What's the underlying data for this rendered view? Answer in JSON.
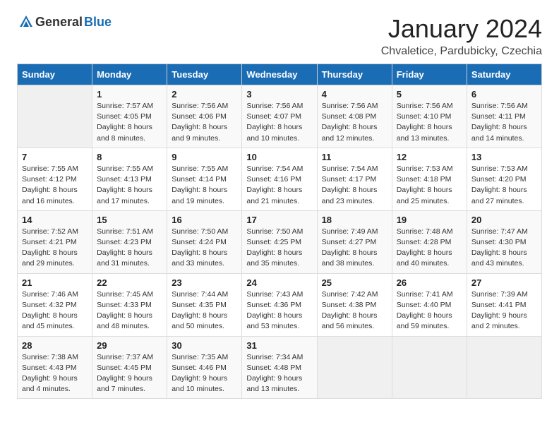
{
  "header": {
    "logo_general": "General",
    "logo_blue": "Blue",
    "title": "January 2024",
    "subtitle": "Chvaletice, Pardubicky, Czechia"
  },
  "weekdays": [
    "Sunday",
    "Monday",
    "Tuesday",
    "Wednesday",
    "Thursday",
    "Friday",
    "Saturday"
  ],
  "weeks": [
    [
      {
        "day": "",
        "info": ""
      },
      {
        "day": "1",
        "info": "Sunrise: 7:57 AM\nSunset: 4:05 PM\nDaylight: 8 hours\nand 8 minutes."
      },
      {
        "day": "2",
        "info": "Sunrise: 7:56 AM\nSunset: 4:06 PM\nDaylight: 8 hours\nand 9 minutes."
      },
      {
        "day": "3",
        "info": "Sunrise: 7:56 AM\nSunset: 4:07 PM\nDaylight: 8 hours\nand 10 minutes."
      },
      {
        "day": "4",
        "info": "Sunrise: 7:56 AM\nSunset: 4:08 PM\nDaylight: 8 hours\nand 12 minutes."
      },
      {
        "day": "5",
        "info": "Sunrise: 7:56 AM\nSunset: 4:10 PM\nDaylight: 8 hours\nand 13 minutes."
      },
      {
        "day": "6",
        "info": "Sunrise: 7:56 AM\nSunset: 4:11 PM\nDaylight: 8 hours\nand 14 minutes."
      }
    ],
    [
      {
        "day": "7",
        "info": "Sunrise: 7:55 AM\nSunset: 4:12 PM\nDaylight: 8 hours\nand 16 minutes."
      },
      {
        "day": "8",
        "info": "Sunrise: 7:55 AM\nSunset: 4:13 PM\nDaylight: 8 hours\nand 17 minutes."
      },
      {
        "day": "9",
        "info": "Sunrise: 7:55 AM\nSunset: 4:14 PM\nDaylight: 8 hours\nand 19 minutes."
      },
      {
        "day": "10",
        "info": "Sunrise: 7:54 AM\nSunset: 4:16 PM\nDaylight: 8 hours\nand 21 minutes."
      },
      {
        "day": "11",
        "info": "Sunrise: 7:54 AM\nSunset: 4:17 PM\nDaylight: 8 hours\nand 23 minutes."
      },
      {
        "day": "12",
        "info": "Sunrise: 7:53 AM\nSunset: 4:18 PM\nDaylight: 8 hours\nand 25 minutes."
      },
      {
        "day": "13",
        "info": "Sunrise: 7:53 AM\nSunset: 4:20 PM\nDaylight: 8 hours\nand 27 minutes."
      }
    ],
    [
      {
        "day": "14",
        "info": "Sunrise: 7:52 AM\nSunset: 4:21 PM\nDaylight: 8 hours\nand 29 minutes."
      },
      {
        "day": "15",
        "info": "Sunrise: 7:51 AM\nSunset: 4:23 PM\nDaylight: 8 hours\nand 31 minutes."
      },
      {
        "day": "16",
        "info": "Sunrise: 7:50 AM\nSunset: 4:24 PM\nDaylight: 8 hours\nand 33 minutes."
      },
      {
        "day": "17",
        "info": "Sunrise: 7:50 AM\nSunset: 4:25 PM\nDaylight: 8 hours\nand 35 minutes."
      },
      {
        "day": "18",
        "info": "Sunrise: 7:49 AM\nSunset: 4:27 PM\nDaylight: 8 hours\nand 38 minutes."
      },
      {
        "day": "19",
        "info": "Sunrise: 7:48 AM\nSunset: 4:28 PM\nDaylight: 8 hours\nand 40 minutes."
      },
      {
        "day": "20",
        "info": "Sunrise: 7:47 AM\nSunset: 4:30 PM\nDaylight: 8 hours\nand 43 minutes."
      }
    ],
    [
      {
        "day": "21",
        "info": "Sunrise: 7:46 AM\nSunset: 4:32 PM\nDaylight: 8 hours\nand 45 minutes."
      },
      {
        "day": "22",
        "info": "Sunrise: 7:45 AM\nSunset: 4:33 PM\nDaylight: 8 hours\nand 48 minutes."
      },
      {
        "day": "23",
        "info": "Sunrise: 7:44 AM\nSunset: 4:35 PM\nDaylight: 8 hours\nand 50 minutes."
      },
      {
        "day": "24",
        "info": "Sunrise: 7:43 AM\nSunset: 4:36 PM\nDaylight: 8 hours\nand 53 minutes."
      },
      {
        "day": "25",
        "info": "Sunrise: 7:42 AM\nSunset: 4:38 PM\nDaylight: 8 hours\nand 56 minutes."
      },
      {
        "day": "26",
        "info": "Sunrise: 7:41 AM\nSunset: 4:40 PM\nDaylight: 8 hours\nand 59 minutes."
      },
      {
        "day": "27",
        "info": "Sunrise: 7:39 AM\nSunset: 4:41 PM\nDaylight: 9 hours\nand 2 minutes."
      }
    ],
    [
      {
        "day": "28",
        "info": "Sunrise: 7:38 AM\nSunset: 4:43 PM\nDaylight: 9 hours\nand 4 minutes."
      },
      {
        "day": "29",
        "info": "Sunrise: 7:37 AM\nSunset: 4:45 PM\nDaylight: 9 hours\nand 7 minutes."
      },
      {
        "day": "30",
        "info": "Sunrise: 7:35 AM\nSunset: 4:46 PM\nDaylight: 9 hours\nand 10 minutes."
      },
      {
        "day": "31",
        "info": "Sunrise: 7:34 AM\nSunset: 4:48 PM\nDaylight: 9 hours\nand 13 minutes."
      },
      {
        "day": "",
        "info": ""
      },
      {
        "day": "",
        "info": ""
      },
      {
        "day": "",
        "info": ""
      }
    ]
  ]
}
